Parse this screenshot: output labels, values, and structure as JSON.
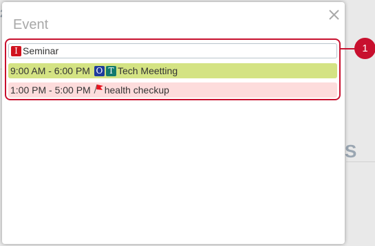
{
  "popup": {
    "title": "Event"
  },
  "events": [
    {
      "tag_letters": [
        "I"
      ],
      "time": "",
      "title": "Seminar"
    },
    {
      "time": "9:00 AM - 6:00 PM",
      "tag_letters": [
        "O",
        "T"
      ],
      "title": "Tech Meetting"
    },
    {
      "time": "1:00 PM - 5:00 PM",
      "tag_letters": [],
      "title": "health checkup"
    }
  ],
  "annotation": {
    "badge_number": "1"
  },
  "colors": {
    "accent_red": "#c8102e",
    "event_green": "#d4e383",
    "event_pink": "#fddcdc",
    "tag_red": "#d0121e",
    "tag_blue": "#1f3b9d",
    "tag_teal": "#137a6e"
  },
  "icons": {
    "close": "close-icon",
    "flag": "flag-icon"
  }
}
